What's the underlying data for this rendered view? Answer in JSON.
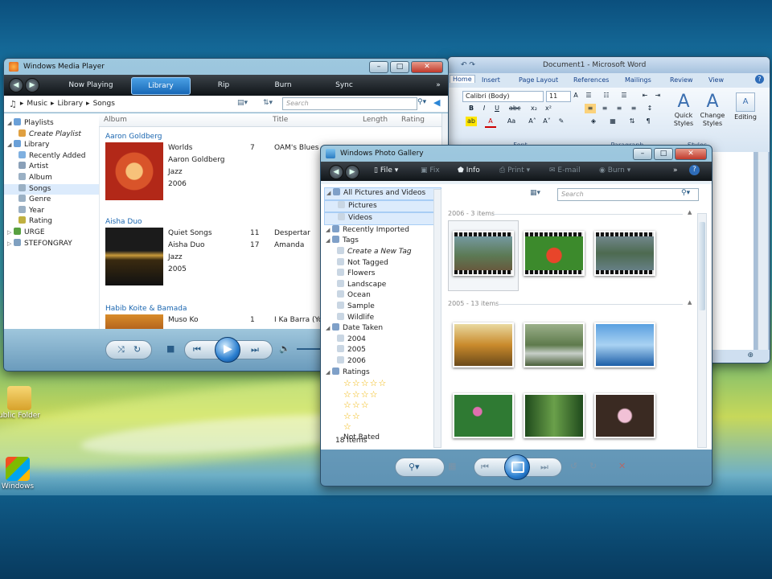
{
  "desktop": {
    "icons": [
      {
        "label": "ublic Folder",
        "icon": "public-folder-icon"
      },
      {
        "label": "Windows",
        "icon": "windows-icon"
      }
    ]
  },
  "wmp": {
    "title": "Windows Media Player",
    "tabs": [
      "Now Playing",
      "Library",
      "Rip",
      "Burn",
      "Sync"
    ],
    "active_tab": "Library",
    "more": "»",
    "breadcrumb": [
      "Music",
      "Library",
      "Songs"
    ],
    "search_placeholder": "Search",
    "nav": [
      {
        "label": "Playlists",
        "type": "header"
      },
      {
        "label": "Create Playlist",
        "type": "item"
      },
      {
        "label": "Library",
        "type": "header"
      },
      {
        "label": "Recently Added",
        "type": "item"
      },
      {
        "label": "Artist",
        "type": "item"
      },
      {
        "label": "Album",
        "type": "item"
      },
      {
        "label": "Songs",
        "type": "item",
        "selected": true
      },
      {
        "label": "Genre",
        "type": "item"
      },
      {
        "label": "Year",
        "type": "item"
      },
      {
        "label": "Rating",
        "type": "item"
      },
      {
        "label": "URGE",
        "type": "header"
      },
      {
        "label": "STEFONGRAY",
        "type": "header"
      }
    ],
    "columns": [
      "Album",
      "Title",
      "Length",
      "Rating"
    ],
    "groups": [
      {
        "artist": "Aaron Goldberg",
        "album": "Worlds",
        "album_artist": "Aaron Goldberg",
        "genre": "Jazz",
        "year": "2006",
        "tracks": [
          {
            "num": "7",
            "title": "OAM's Blues"
          }
        ]
      },
      {
        "artist": "Aisha Duo",
        "album": "Quiet Songs",
        "album_artist": "Aisha Duo",
        "genre": "Jazz",
        "year": "2005",
        "tracks": [
          {
            "num": "11",
            "title": "Despertar"
          },
          {
            "num": "17",
            "title": "Amanda"
          }
        ]
      },
      {
        "artist": "Habib Koite & Bamada",
        "album": "Muso Ko",
        "tracks": [
          {
            "num": "1",
            "title": "I Ka Barra (Your"
          }
        ]
      }
    ]
  },
  "word": {
    "title_doc": "Document1",
    "title_app": "Microsoft Word",
    "tabs": [
      "Home",
      "Insert",
      "Page Layout",
      "References",
      "Mailings",
      "Review",
      "View"
    ],
    "font_name": "Calibri (Body)",
    "font_size": "11",
    "groups": [
      "Font",
      "Paragraph",
      "Styles"
    ],
    "quick_styles": "Quick Styles",
    "change_styles": "Change Styles",
    "editing": "Editing"
  },
  "gallery": {
    "title": "Windows Photo Gallery",
    "commands": {
      "file": "File",
      "fix": "Fix",
      "info": "Info",
      "print": "Print",
      "email": "E-mail",
      "burn": "Burn"
    },
    "search_placeholder": "Search",
    "nav": [
      {
        "label": "All Pictures and Videos",
        "level": 0,
        "selected": true
      },
      {
        "label": "Pictures",
        "level": 1,
        "selected": true
      },
      {
        "label": "Videos",
        "level": 1,
        "selected": true
      },
      {
        "label": "Recently Imported",
        "level": 0
      },
      {
        "label": "Tags",
        "level": 0
      },
      {
        "label": "Create a New Tag",
        "level": 1
      },
      {
        "label": "Not Tagged",
        "level": 1
      },
      {
        "label": "Flowers",
        "level": 1
      },
      {
        "label": "Landscape",
        "level": 1
      },
      {
        "label": "Ocean",
        "level": 1
      },
      {
        "label": "Sample",
        "level": 1
      },
      {
        "label": "Wildlife",
        "level": 1
      },
      {
        "label": "Date Taken",
        "level": 0
      },
      {
        "label": "2004",
        "level": 1
      },
      {
        "label": "2005",
        "level": 1
      },
      {
        "label": "2006",
        "level": 1
      },
      {
        "label": "Ratings",
        "level": 0
      }
    ],
    "ratings": [
      5,
      4,
      3,
      2,
      1
    ],
    "not_rated": "Not Rated",
    "item_count": "18 items",
    "groups": [
      {
        "label": "2006 - 3 items",
        "thumbs": [
          "bear-video",
          "bird-video",
          "lake-video"
        ]
      },
      {
        "label": "2005 - 13 items",
        "thumbs": [
          "autumn-tree",
          "creek",
          "ocean-dock",
          "pink-flowers-green",
          "forest-path",
          "orchids"
        ]
      }
    ]
  }
}
